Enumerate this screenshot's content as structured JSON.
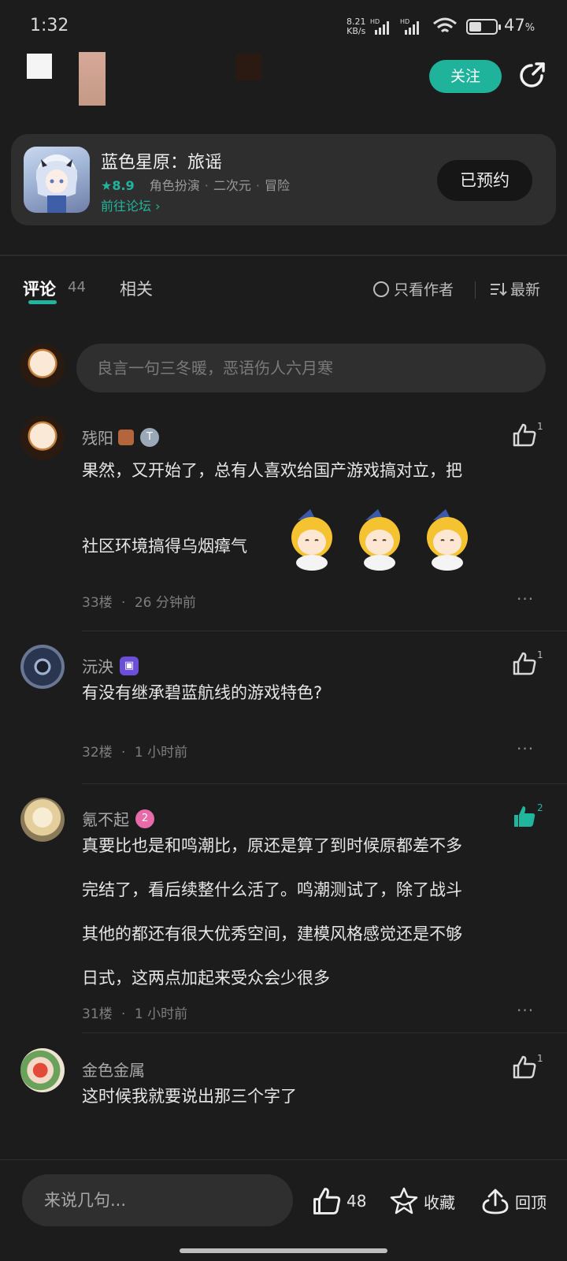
{
  "status_bar": {
    "time": "1:32",
    "net_speed_value": "8.21",
    "net_speed_unit": "KB/s",
    "signal1_label": "HD",
    "signal2_label": "HD",
    "battery_pct": "47",
    "battery_pct_sign": "%",
    "battery_level": 0.47
  },
  "header": {
    "follow_label": "关注",
    "share_icon": "share-icon"
  },
  "game_card": {
    "name": "蓝色星原：旅谣",
    "rating": "★8.9",
    "tags": [
      "角色扮演",
      "二次元",
      "冒险"
    ],
    "forum_link": "前往论坛",
    "reserve_label": "已预约"
  },
  "tabs": {
    "comments_label": "评论",
    "comments_count": "44",
    "related_label": "相关",
    "author_only_label": "只看作者",
    "sort_label": "最新"
  },
  "comment_input": {
    "placeholder": "良言一句三冬暖，恶语伤人六月寒"
  },
  "comments": [
    {
      "user": "残阳",
      "lines": [
        "果然，又开始了，总有人喜欢给国产游戏搞对立，把",
        "社区环境搞得乌烟瘴气"
      ],
      "floor": "33楼",
      "time": "26 分钟前",
      "likes": "1",
      "liked": false
    },
    {
      "user": "沅泱",
      "lines": [
        "有没有继承碧蓝航线的游戏特色?"
      ],
      "floor": "32楼",
      "time": "1 小时前",
      "likes": "1",
      "liked": false
    },
    {
      "user": "氪不起",
      "lines": [
        "真要比也是和鸣潮比，原还是算了到时候原都差不多",
        "完结了，看后续整什么活了。鸣潮测试了，除了战斗",
        "其他的都还有很大优秀空间，建模风格感觉还是不够",
        "日式，这两点加起来受众会少很多"
      ],
      "floor": "31楼",
      "time": "1 小时前",
      "likes": "2",
      "liked": true,
      "badge": "2"
    },
    {
      "user": "金色金属",
      "lines": [
        "这时候我就要说出那三个字了"
      ],
      "likes": "1",
      "liked": false
    }
  ],
  "meta_separator": "·",
  "more_label": "···",
  "bottom_bar": {
    "input_placeholder": "来说几句...",
    "like_count": "48",
    "favorite_label": "收藏",
    "top_label": "回顶"
  },
  "colors": {
    "accent": "#22b59e",
    "background": "#1c1c1c"
  }
}
